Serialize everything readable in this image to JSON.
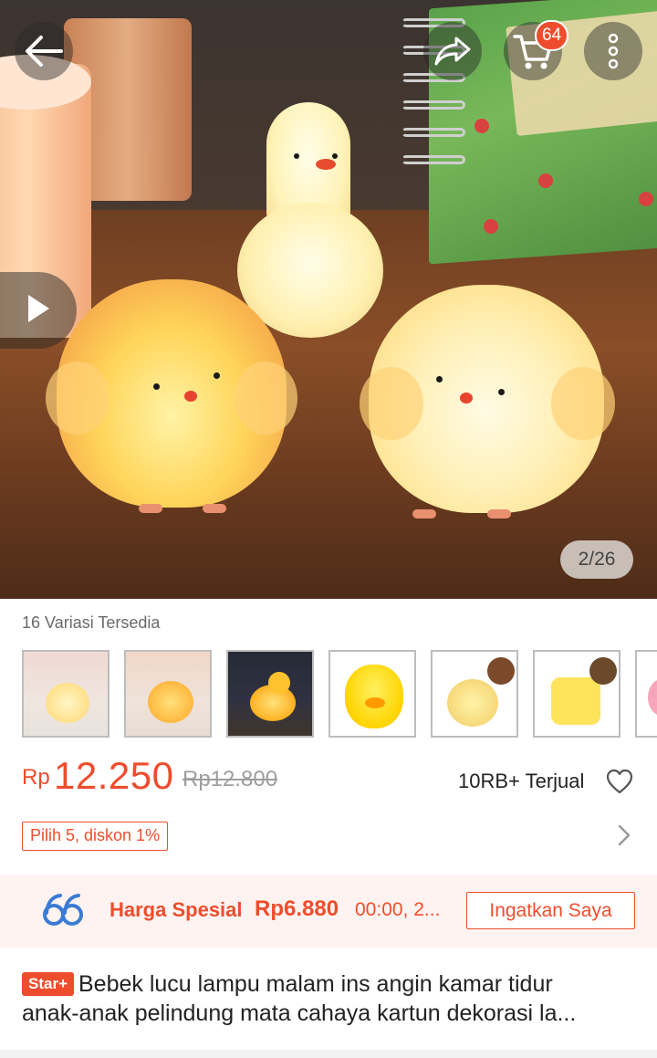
{
  "hero": {
    "image_counter": "2/26",
    "cart_count": "64",
    "icons": {
      "back": "arrow-left-icon",
      "share": "share-icon",
      "cart": "cart-icon",
      "more": "more-vertical-icon",
      "play": "play-icon"
    }
  },
  "variations": {
    "label": "16 Variasi Tersedia",
    "thumbnails": [
      "chick-light-white",
      "chick-light-orange",
      "duck-light-dark",
      "yellow-chick-toy",
      "pineapple-pig-toy",
      "sponge-toy",
      "partial-toy"
    ]
  },
  "price": {
    "currency": "Rp",
    "current": "12.250",
    "original": "Rp12.800",
    "sold": "10RB+ Terjual"
  },
  "promo": {
    "discount_tag": "Pilih 5, diskon 1%"
  },
  "special_price": {
    "label": "Harga Spesial",
    "price": "Rp6.880",
    "time": "00:00, 2...",
    "remind_button": "Ingatkan Saya"
  },
  "product": {
    "badge": "Star+",
    "title_line1": "Bebek lucu lampu malam ins angin kamar tidur",
    "title_line2": "anak-anak pelindung mata cahaya kartun dekorasi la..."
  },
  "colors": {
    "accent": "#ee4d2d",
    "banner_bg": "#fff3f1"
  }
}
